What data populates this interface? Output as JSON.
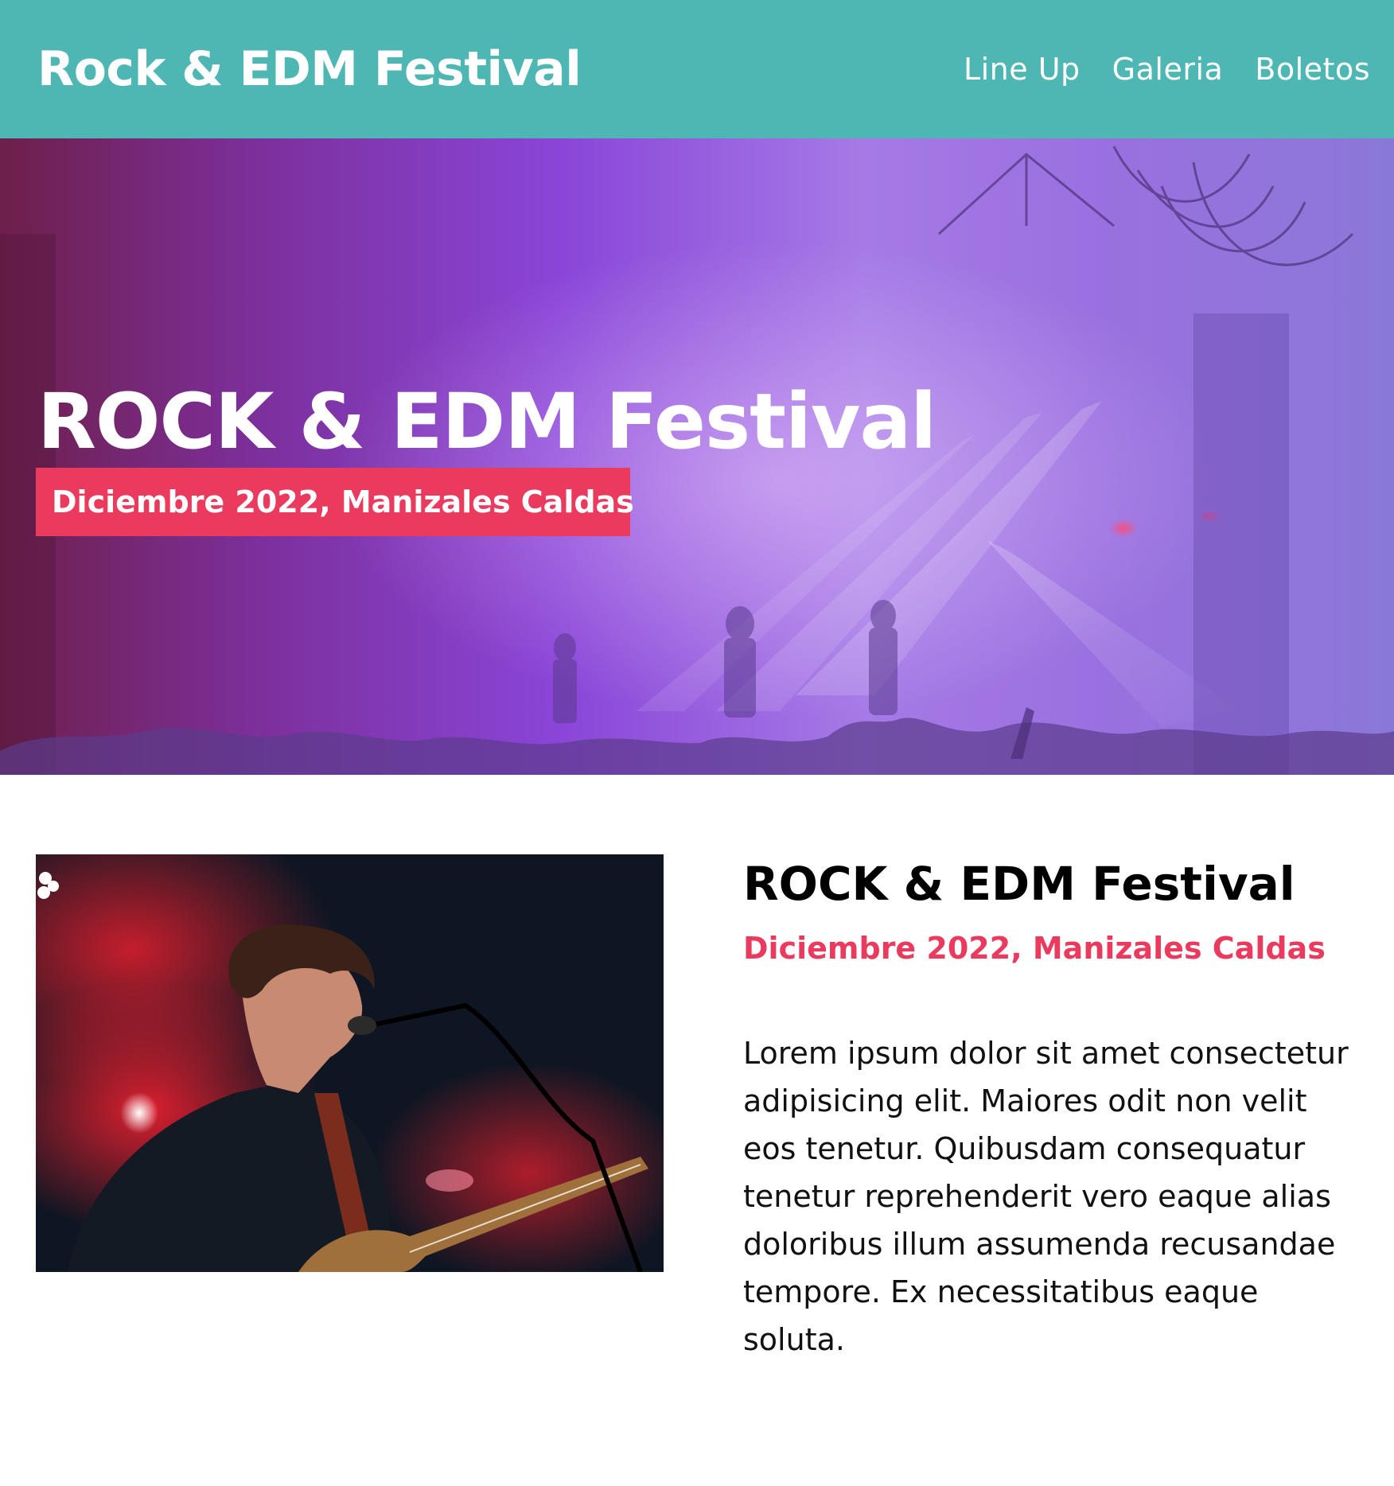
{
  "header": {
    "title": "Rock & EDM Festival",
    "nav": [
      {
        "label": "Line Up"
      },
      {
        "label": "Galeria"
      },
      {
        "label": "Boletos"
      }
    ]
  },
  "hero": {
    "title": "ROCK & EDM Festival",
    "subtitle": "Diciembre 2022, Manizales Caldas"
  },
  "content": {
    "title": "ROCK & EDM Festival",
    "date": "Diciembre 2022, Manizales Caldas",
    "body": "Lorem ipsum dolor sit amet consectetur adipisicing elit. Maiores odit non velit eos tenetur. Quibusdam consequatur tenetur reprehenderit vero eaque alias doloribus illum assumenda recusandae tempore. Ex necessitatibus eaque soluta."
  },
  "colors": {
    "header_bg": "#4fb7b3",
    "accent": "#ea3b5e",
    "hero_purple": "#8a45d8"
  }
}
